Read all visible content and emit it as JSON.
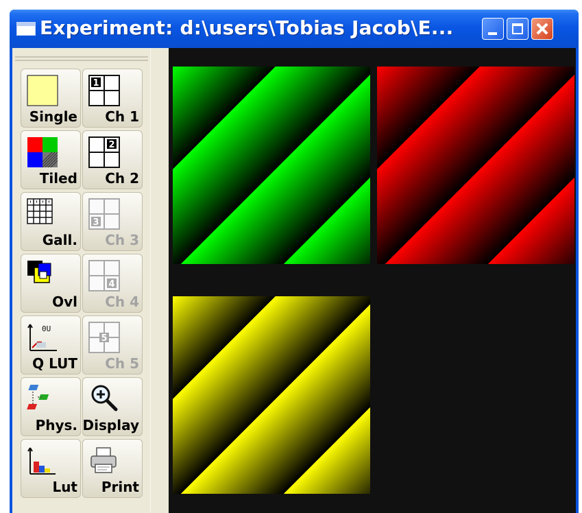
{
  "window": {
    "title": "Experiment: d:\\users\\Tobias Jacob\\E..."
  },
  "titlebar_buttons": {
    "minimize": "minimize",
    "maximize": "maximize",
    "close": "close"
  },
  "toolbar": {
    "single": "Single",
    "ch1": "Ch 1",
    "tiled": "Tiled",
    "ch2": "Ch 2",
    "gallery": "Gall.",
    "ch3": "Ch 3",
    "overlay": "Ovl",
    "ch4": "Ch 4",
    "qlut": "Q LUT",
    "ch5": "Ch 5",
    "phys": "Phys.",
    "display": "Display",
    "lut": "Lut",
    "print": "Print"
  },
  "channel_numbers": {
    "ch1": "1",
    "ch2": "2",
    "ch3": "3",
    "ch4": "4",
    "ch5": "5"
  },
  "qlut_icon_text": "0U",
  "colors": {
    "channel_green": "#00ff00",
    "channel_red": "#ff0000",
    "channel_yellow": "#ffff00",
    "viewport_bg": "#111111",
    "titlebar_blue": "#0a54e0"
  },
  "icons": {
    "single": "single-view-icon",
    "tiled": "tiled-view-icon",
    "gallery": "gallery-view-icon",
    "overlay": "overlay-icon",
    "qlut": "quick-lut-icon",
    "phys": "physical-units-icon",
    "display": "zoom-display-icon",
    "lut": "lut-icon",
    "print": "printer-icon"
  }
}
